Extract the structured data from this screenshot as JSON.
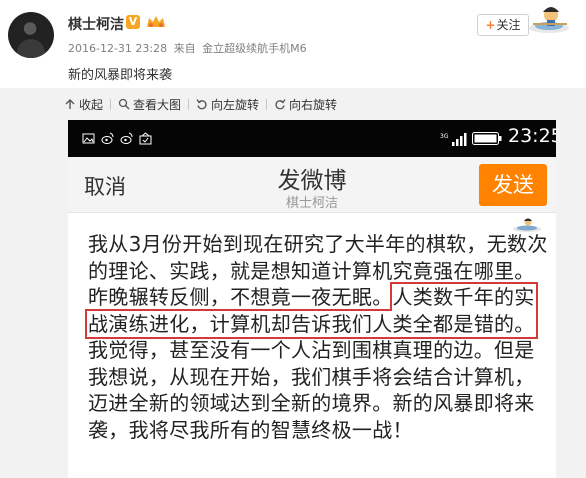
{
  "post": {
    "username": "棋士柯洁",
    "verified_badge": "V",
    "timestamp": "2016-12-31 23:28",
    "source_prefix": "来自",
    "source": "金立超级续航手机M6",
    "text": "新的风暴即将来袭",
    "follow_plus": "+",
    "follow_label": "关注"
  },
  "viewer_toolbar": {
    "items": [
      {
        "icon": "collapse-arrow-icon",
        "label": "收起"
      },
      {
        "icon": "magnifier-icon",
        "label": "查看大图"
      },
      {
        "icon": "rotate-left-icon",
        "label": "向左旋转"
      },
      {
        "icon": "rotate-right-icon",
        "label": "向右旋转"
      }
    ]
  },
  "phone": {
    "status_time": "23:25",
    "network_label": "3G",
    "compose": {
      "cancel": "取消",
      "title": "发微博",
      "subtitle": "棋士柯洁",
      "send": "发送",
      "text_part1": "我从3月份开始到现在研究了大半年的棋软，无数次的理论、实践，就是想知道计算机究竟强在哪里。昨晚辗转反侧，不想竟一夜无眠。",
      "text_highlight": "人类数千年的实战演练进化，计算机却告诉我们人类全都是错的。",
      "text_part2": "我觉得，甚至没有一个人沾到围棋真理的边。但是我想说，从现在开始，我们棋手将会结合计算机，迈进全新的领域达到全新的境界。新的风暴即将来袭，我将尽我所有的智慧终极一战！"
    }
  },
  "colors": {
    "accent_orange": "#ff8200",
    "highlight_red": "#d43a3a",
    "badge_gold": "#f5a623"
  }
}
